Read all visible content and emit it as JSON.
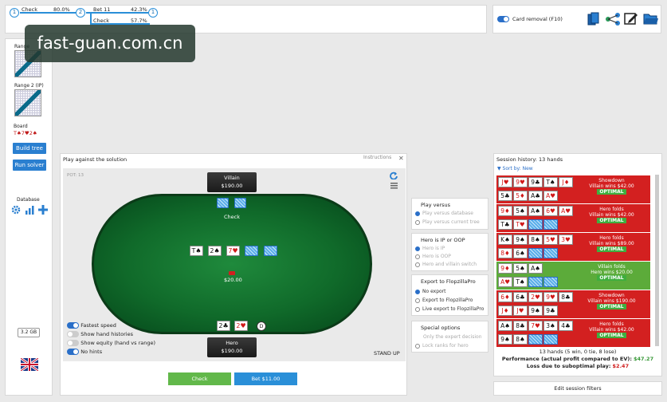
{
  "tree": {
    "nodes": [
      "1",
      "2",
      "1"
    ],
    "action1": "Check",
    "action1_pct": "80.0%",
    "action2a": "Bet 11",
    "action2a_pct": "42.3%",
    "action2b": "Check",
    "action2b_pct": "57.7%"
  },
  "watermark": "fast-guan.com.cn",
  "top_right": {
    "card_removal": "Card removal (F10)"
  },
  "sidebar": {
    "range1": "Range",
    "range2": "Range 2 (IP)",
    "board_label": "Board",
    "board_cards": "T♠7♥2♠",
    "build_tree": "Build tree",
    "run_solver": "Run solver",
    "database": "Database",
    "memory": "3.2 GB"
  },
  "play": {
    "title": "Play against the solution",
    "instructions": "Instructions",
    "pot_label": "POT: 13",
    "villain_name": "Villain",
    "villain_stack": "$190.00",
    "villain_action": "Check",
    "board": [
      {
        "r": "T",
        "s": "♠",
        "red": false
      },
      {
        "r": "2",
        "s": "♠",
        "red": false
      },
      {
        "r": "7",
        "s": "♥",
        "red": true
      }
    ],
    "pot": "$20.00",
    "hero_cards": [
      {
        "r": "2",
        "s": "♣",
        "red": false
      },
      {
        "r": "2",
        "s": "♥",
        "red": true
      }
    ],
    "dealer": "D",
    "hero_name": "Hero",
    "hero_stack": "$190.00",
    "stand_up": "STAND UP",
    "toggles": [
      "Fastest speed",
      "Show hand histories",
      "Show equity (hand vs range)",
      "No hints"
    ],
    "btn_check": "Check",
    "btn_bet": "Bet $11.00"
  },
  "options": {
    "play_versus": "Play versus",
    "pv_opts": [
      "Play versus database",
      "Play versus current tree"
    ],
    "hero_pos": "Hero is IP or OOP",
    "hp_opts": [
      "Hero is IP",
      "Hero is OOP",
      "Hero and villain switch"
    ],
    "export": "Export to FlopzillaPro",
    "ex_opts": [
      "No export",
      "Export to FlopzillaPro",
      "Live export to FlopzillaPro"
    ],
    "special": "Special options",
    "sp_opts": [
      "Only the expert decision",
      "Lock ranks for hero"
    ]
  },
  "history": {
    "title": "Session history: 13 hands",
    "sort": "▼ Sort by: New",
    "rows": [
      {
        "c1": [
          {
            "r": "J",
            "s": "♥",
            "red": true
          },
          {
            "r": "9",
            "s": "♥",
            "red": true
          },
          {
            "r": "9",
            "s": "♣",
            "red": false
          },
          {
            "r": "T",
            "s": "♠",
            "red": false
          },
          {
            "r": "J",
            "s": "♦",
            "red": true
          }
        ],
        "c2": [
          {
            "r": "5",
            "s": "♣",
            "red": false
          },
          {
            "r": "5",
            "s": "♦",
            "red": true
          },
          {
            "r": "A",
            "s": "♣",
            "red": false
          },
          {
            "r": "A",
            "s": "♥",
            "red": true
          }
        ],
        "l1": "Showdown",
        "l2": "Villain wins $42.00",
        "opt": "OPTIMAL",
        "color": "#d32020"
      },
      {
        "c1": [
          {
            "r": "9",
            "s": "♦",
            "red": true
          },
          {
            "r": "5",
            "s": "♠",
            "red": false
          },
          {
            "r": "A",
            "s": "♠",
            "red": false
          },
          {
            "r": "6",
            "s": "♥",
            "red": true
          },
          {
            "r": "A",
            "s": "♥",
            "red": true
          }
        ],
        "c2": [
          {
            "r": "T",
            "s": "♣",
            "red": false
          },
          {
            "r": "T",
            "s": "♥",
            "red": true
          }
        ],
        "l1": "Hero folds",
        "l2": "Villain wins $42.00",
        "opt": "OPTIMAL",
        "color": "#d32020"
      },
      {
        "c1": [
          {
            "r": "K",
            "s": "♠",
            "red": false
          },
          {
            "r": "9",
            "s": "♠",
            "red": false
          },
          {
            "r": "8",
            "s": "♠",
            "red": false
          },
          {
            "r": "5",
            "s": "♥",
            "red": true
          },
          {
            "r": "3",
            "s": "♥",
            "red": true
          }
        ],
        "c2": [
          {
            "r": "8",
            "s": "♦",
            "red": true
          },
          {
            "r": "6",
            "s": "♠",
            "red": false
          }
        ],
        "l1": "Hero folds",
        "l2": "Villain wins $89.00",
        "opt": "OPTIMAL",
        "color": "#d32020"
      },
      {
        "c1": [
          {
            "r": "9",
            "s": "♦",
            "red": true
          },
          {
            "r": "5",
            "s": "♠",
            "red": false
          },
          {
            "r": "A",
            "s": "♠",
            "red": false
          }
        ],
        "c2": [
          {
            "r": "A",
            "s": "♥",
            "red": true
          },
          {
            "r": "T",
            "s": "♠",
            "red": false
          }
        ],
        "l1": "Villain folds",
        "l2": "Hero wins $20.00",
        "opt": "OPTIMAL",
        "color": "#5cab3a"
      },
      {
        "c1": [
          {
            "r": "6",
            "s": "♦",
            "red": true
          },
          {
            "r": "6",
            "s": "♣",
            "red": false
          },
          {
            "r": "2",
            "s": "♥",
            "red": true
          },
          {
            "r": "9",
            "s": "♥",
            "red": true
          },
          {
            "r": "8",
            "s": "♣",
            "red": false
          }
        ],
        "c2": [
          {
            "r": "J",
            "s": "♦",
            "red": true
          },
          {
            "r": "J",
            "s": "♥",
            "red": true
          },
          {
            "r": "9",
            "s": "♠",
            "red": false
          },
          {
            "r": "9",
            "s": "♣",
            "red": false
          }
        ],
        "l1": "Showdown",
        "l2": "Villain wins $190.00",
        "opt": "OPTIMAL",
        "color": "#d32020"
      },
      {
        "c1": [
          {
            "r": "A",
            "s": "♠",
            "red": false
          },
          {
            "r": "8",
            "s": "♣",
            "red": false
          },
          {
            "r": "7",
            "s": "♥",
            "red": true
          },
          {
            "r": "3",
            "s": "♠",
            "red": false
          },
          {
            "r": "4",
            "s": "♣",
            "red": false
          }
        ],
        "c2": [
          {
            "r": "9",
            "s": "♠",
            "red": false
          },
          {
            "r": "8",
            "s": "♠",
            "red": false
          }
        ],
        "l1": "Hero folds",
        "l2": "Villain wins $42.00",
        "opt": "OPTIMAL",
        "color": "#d32020"
      }
    ],
    "summary": "13 hands (5 win, 0 tie, 8 lose)",
    "perf_label": "Performance (actual profit compared to EV):",
    "perf_value": "$47.27",
    "loss_label": "Loss due to suboptimal play:",
    "loss_value": "$2.47",
    "edit_filters": "Edit session filters"
  }
}
